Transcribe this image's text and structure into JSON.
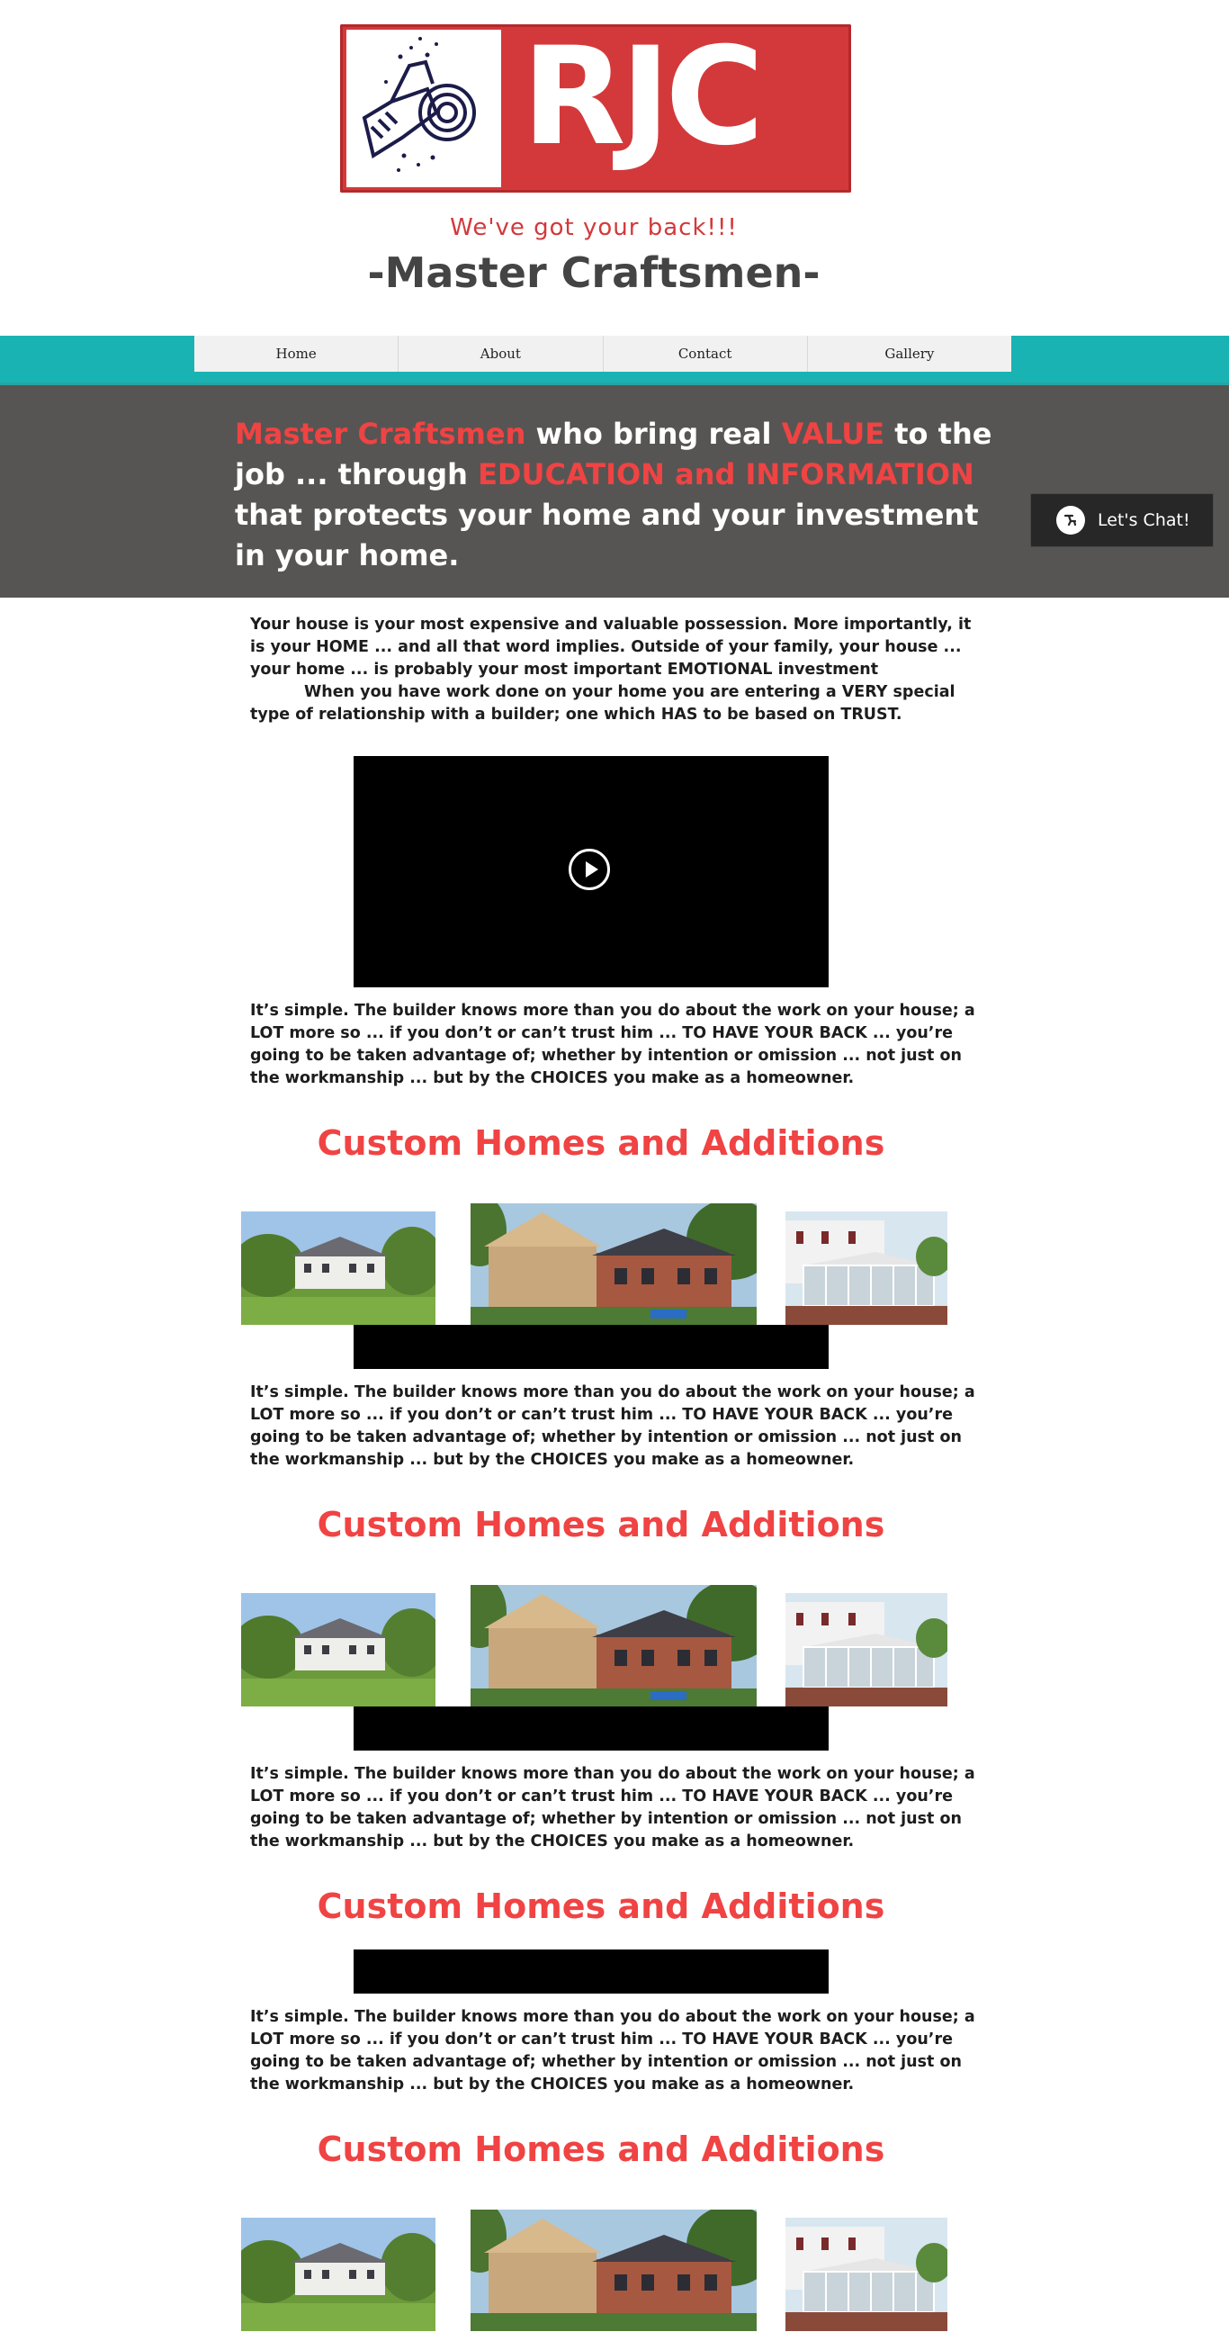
{
  "header": {
    "logo_text": "RJC",
    "tagline": "We've got your back!!!",
    "subtitle": "-Master Craftsmen-"
  },
  "nav": {
    "items": [
      {
        "label": "Home"
      },
      {
        "label": "About"
      },
      {
        "label": "Contact"
      },
      {
        "label": "Gallery"
      }
    ]
  },
  "hero": {
    "part1": "Master Craftsmen",
    "part2": " who bring real ",
    "part3": "VALUE",
    "part4": " to the job ... through ",
    "part5": "EDUCATION and INFORMATION",
    "part6": " that protects your home and your investment in your home."
  },
  "chat": {
    "label": "Let's Chat!"
  },
  "intro": {
    "line1": "Your house is your most expensive and valuable possession.  More importantly, it is your HOME ... and all that word implies.  Outside of  your family, your house ... your home ... is probably  your most important EMOTIONAL investment",
    "line2": "When you have work done on your home you are entering a VERY special type of relationship with a builder; one which HAS to be based on TRUST."
  },
  "trust_text": "It’s simple.  The builder knows more than you do about the work on your house; a LOT more so ... if you don’t or can’t trust him ... TO HAVE YOUR BACK ... you’re going to be taken advantage of; whether by intention or omission ... not just on the workmanship ... but by the CHOICES you make as a homeowner.",
  "section_title": "Custom Homes and Additions",
  "colors": {
    "accent_red": "#f04343",
    "logo_red": "#d3393b",
    "nav_teal": "#1ab3b3",
    "hero_gray": "#575553"
  },
  "icons": {
    "logo": "saw-blade-icon",
    "chat": "chat-icon",
    "play": "play-icon"
  }
}
